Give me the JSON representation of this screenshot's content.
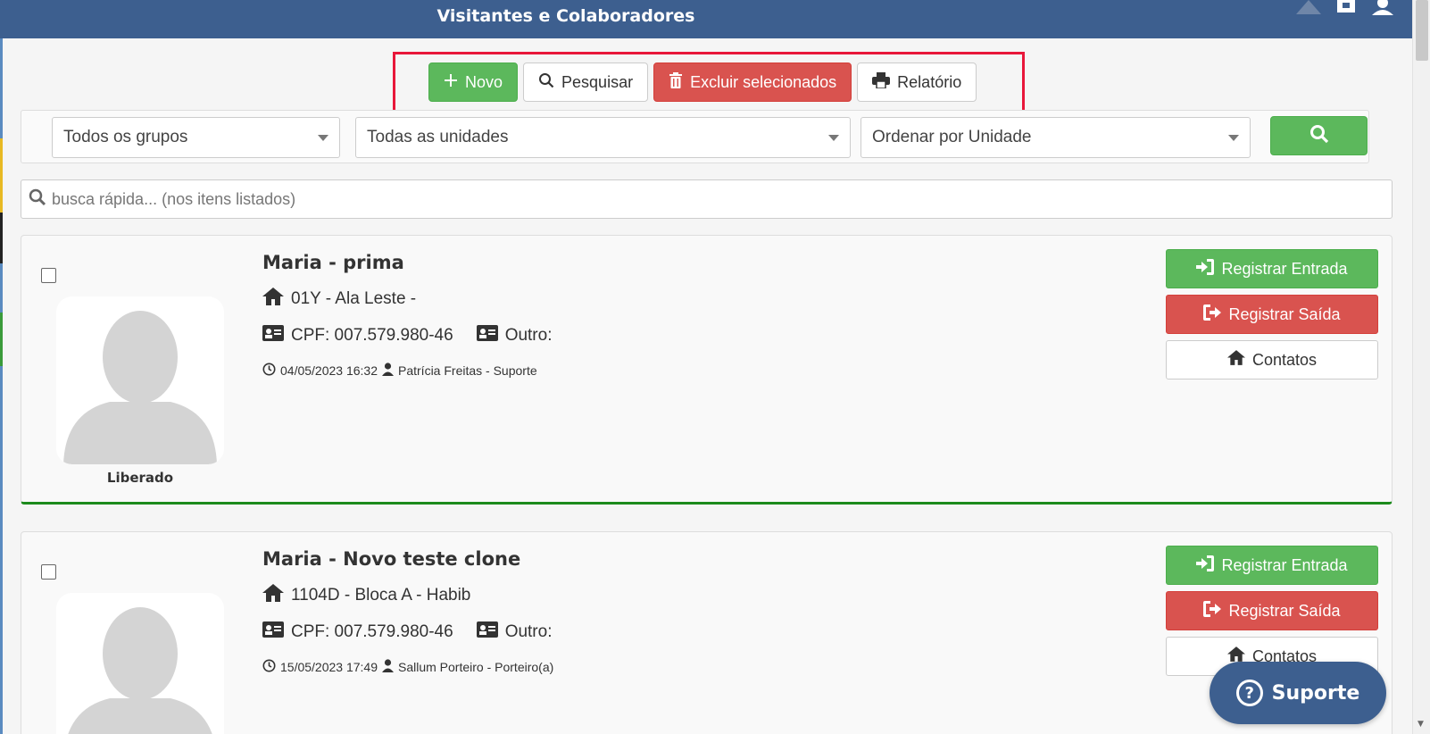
{
  "header": {
    "title": "Visitantes e Colaboradores",
    "icons": [
      "warning-icon",
      "expand-icon",
      "user-icon"
    ]
  },
  "toolbar": {
    "new_label": "Novo",
    "search_label": "Pesquisar",
    "delete_label": "Excluir selecionados",
    "report_label": "Relatório"
  },
  "filters": {
    "group": "Todos os grupos",
    "unit": "Todas as unidades",
    "order": "Ordenar por Unidade"
  },
  "quick_search": {
    "placeholder": "busca rápida... (nos itens listados)"
  },
  "cards": [
    {
      "name": "Maria - prima",
      "unit": "01Y - Ala Leste -",
      "cpf": "CPF: 007.579.980-46",
      "other": "Outro:",
      "datetime": "04/05/2023 16:32",
      "user": "Patrícia Freitas - Suporte",
      "status": "Liberado",
      "btn_entry": "Registrar Entrada",
      "btn_exit": "Registrar Saída",
      "btn_contacts": "Contatos"
    },
    {
      "name": "Maria - Novo teste clone",
      "unit": "1104D - Bloca A - Habib",
      "cpf": "CPF: 007.579.980-46",
      "other": "Outro:",
      "datetime": "15/05/2023 17:49",
      "user": "Sallum Porteiro - Porteiro(a)",
      "btn_entry": "Registrar Entrada",
      "btn_exit": "Registrar Saída",
      "btn_contacts": "Contatos"
    }
  ],
  "support": {
    "label": "Suporte"
  },
  "colors": {
    "header": "#3d5f8f",
    "success": "#5cb85c",
    "danger": "#d9534f",
    "highlight": "#e8173a",
    "status_ok": "#1c8a1c"
  }
}
